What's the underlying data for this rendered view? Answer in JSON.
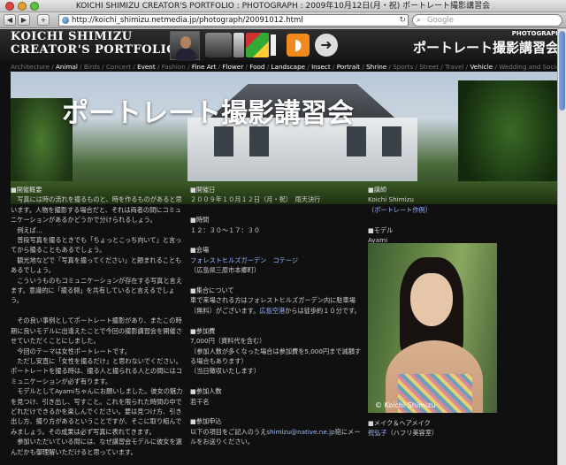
{
  "window": {
    "title": "KOICHI SHIMIZU CREATOR'S PORTFOLIO : PHOTOGRAPH : 2009年10月12日(月・祝) ポートレート撮影講習会"
  },
  "toolbar": {
    "back": "◀",
    "forward": "▶",
    "add": "+",
    "url": "http://koichi_shimizu.netmedia.jp/photograph/20091012.html",
    "search_placeholder": "Google"
  },
  "header": {
    "logo_line1": "KOICHI SHIMIZU",
    "logo_line2": "CREATOR'S PORTFOLIO",
    "section_en": "PHOTOGRAPH",
    "section_jp": "ポートレート撮影講習会"
  },
  "nav": [
    {
      "label": "Architecture",
      "active": false
    },
    {
      "label": "Animal",
      "active": true
    },
    {
      "label": "Birds",
      "active": false
    },
    {
      "label": "Concert",
      "active": false
    },
    {
      "label": "Event",
      "active": true
    },
    {
      "label": "Fashion",
      "active": false
    },
    {
      "label": "Fine Art",
      "active": true
    },
    {
      "label": "Flower",
      "active": true
    },
    {
      "label": "Food",
      "active": true
    },
    {
      "label": "Landscape",
      "active": true
    },
    {
      "label": "Insect",
      "active": true
    },
    {
      "label": "Portrait",
      "active": true
    },
    {
      "label": "Shrine",
      "active": true
    },
    {
      "label": "Sports",
      "active": false
    },
    {
      "label": "Street",
      "active": false
    },
    {
      "label": "Travel",
      "active": false
    },
    {
      "label": "Vehicle",
      "active": true
    },
    {
      "label": "Wedding and Social",
      "active": false
    }
  ],
  "banner": {
    "title": "ポートレート撮影講習会"
  },
  "col1": [
    "■開催概要",
    "　写真には時の流れを撮るものと、時を作るものがあると思います。人物を撮影する場合だと、それは両者の間にコミュニケーションがあるかどうかで分けられるしょう。",
    "　例えば…",
    "　普段写真を撮るときでも「ちょっとこっち向いて」と言ってから撮ることもあるでしょう。",
    "　観光地などで「写真を撮ってください」と頼まれることもあるでしょう。",
    "　こういうものもコミュニケーションが存在する写真と言えます。意識的に「撮る側」を共有していると言えるでしょう。",
    "",
    "　その良い事例としてポートレート撮影があり、またこの時期に良いモデルに出逢えたことで今回の撮影講習会を開催させていただくことにしました。",
    "　今回のテーマは女性ポートレートです。",
    "　ただし安直に「女性を撮るだけ」と思わないでください。ポートレートを撮る時は、撮る人と撮られる人との間にはコミュニケーションが必ず有ります。",
    "　モデルとしてAyamiちゃんにお願いしました。彼女の魅力を見つけ、引き出し、写すこと。これを限られた時間の中でどれだけできるかを楽しんでください。要は見つけ方、引き出し方、撮り方があるということですが、そこに取り組んでみましょう。その成果は必ず写真に表れてきます。",
    "　参加いただいている間には、なぜ講習会モデルに彼女を選んだかも御理解いただけると思っています。"
  ],
  "col2": {
    "date_h": "■開催日",
    "date": "２００９年１０月１２日（月・祝）　雨天決行",
    "time_h": "■時間",
    "time": "１２：３０～１７：３０",
    "venue_h": "■会場",
    "venue_link": "フォレストヒルズガーデン　コテージ",
    "venue_note": "（広島県三原市本郷町）",
    "gather_h": "■集合について",
    "gather_pre": "車で来場される方はフォレストヒルズガーデン内に駐車場（無料）がございます。",
    "gather_link": "広島空港",
    "gather_post": "からは徒歩約１０分です。",
    "fee_h": "■参加費",
    "fee": "7,000円（資料代を含む）",
    "fee_note1": "（参加人数が多くなった場合は参加費を5,000円まで減額する場合もあります）",
    "fee_note2": "（当日徴収いたします）",
    "cap_h": "■参加人数",
    "cap": "若干名",
    "apply_h": "■参加申込",
    "apply_pre": "以下の項目をご記入のうえ",
    "apply_link": "shimizu@native.ne.jp",
    "apply_post": "宛にメールをお送りください。"
  },
  "col3": {
    "instructor_h": "■講師",
    "instructor": "Koichi Shimizu",
    "instructor_link": "（ポートレート作例）",
    "model_h": "■モデル",
    "model": "Ayami",
    "photo_credit": "© Koichi Shimizu",
    "makeup_h": "■メイク＆ヘアメイク",
    "makeup_link": "祝弘子",
    "makeup_post": "（ハフリ美容室）"
  }
}
